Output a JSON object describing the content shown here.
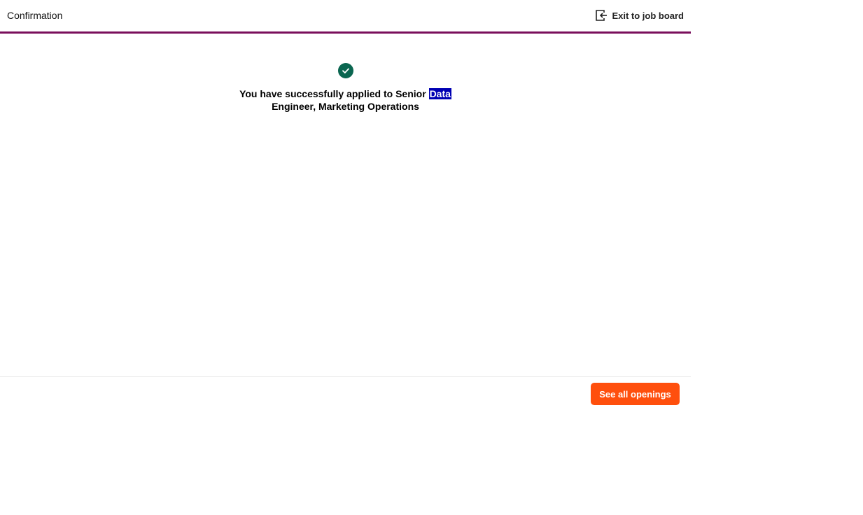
{
  "header": {
    "title": "Confirmation",
    "exit_label": "Exit to job board",
    "exit_icon": "exit-door-icon",
    "accent_color": "#7a0f5c"
  },
  "confirmation": {
    "status_icon": "check-circle-icon",
    "status_color": "#0a6650",
    "message_before": "You have successfully applied to Senior",
    "message_highlight": "Data",
    "message_after": "Engineer, Marketing Operations"
  },
  "footer": {
    "see_all_label": "See all openings",
    "button_color": "#ff4f0d"
  }
}
